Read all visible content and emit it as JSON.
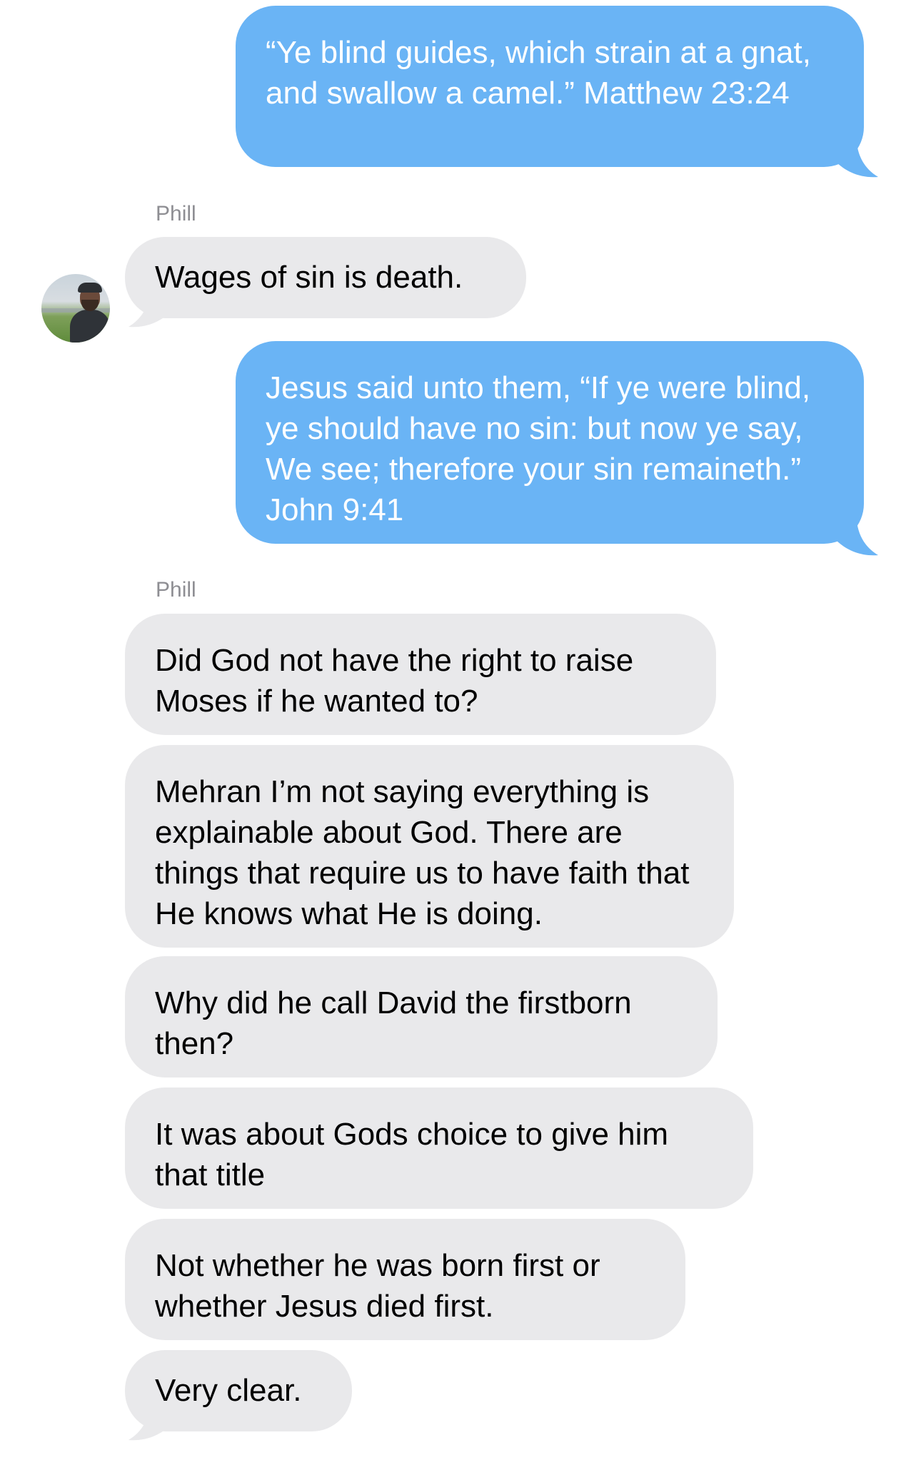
{
  "conversation": {
    "contact_name": "Phill",
    "messages": [
      {
        "id": "m1",
        "direction": "outgoing",
        "text": "“Ye blind guides, which strain at a gnat, and swallow a camel.” Matthew 23:24"
      },
      {
        "id": "m2",
        "direction": "incoming",
        "sender": "Phill",
        "text": "Wages of sin is death."
      },
      {
        "id": "m3",
        "direction": "outgoing",
        "text": "Jesus said unto them, “If ye were blind, ye should have no sin: but now ye say, We see; therefore your sin remaineth.” John 9:41"
      },
      {
        "id": "m4",
        "direction": "incoming",
        "sender": "Phill",
        "text": "Did God not have the right to raise Moses if he wanted to?"
      },
      {
        "id": "m5",
        "direction": "incoming",
        "text": "Mehran I’m not saying everything is explainable about God. There are things that require us to have faith that He knows what He is doing."
      },
      {
        "id": "m6",
        "direction": "incoming",
        "text": "Why did he call David the firstborn then?"
      },
      {
        "id": "m7",
        "direction": "incoming",
        "text": "It was about Gods choice to give him that title"
      },
      {
        "id": "m8",
        "direction": "incoming",
        "text": "Not whether he was born first or whether Jesus died first."
      },
      {
        "id": "m9",
        "direction": "incoming",
        "text": "Very clear."
      }
    ]
  },
  "colors": {
    "outgoing_bubble": "#6AB4F5",
    "incoming_bubble": "#E9E9EB",
    "sender_label": "#8e8e93"
  },
  "icons": {
    "avatar": "contact-avatar-photo"
  }
}
